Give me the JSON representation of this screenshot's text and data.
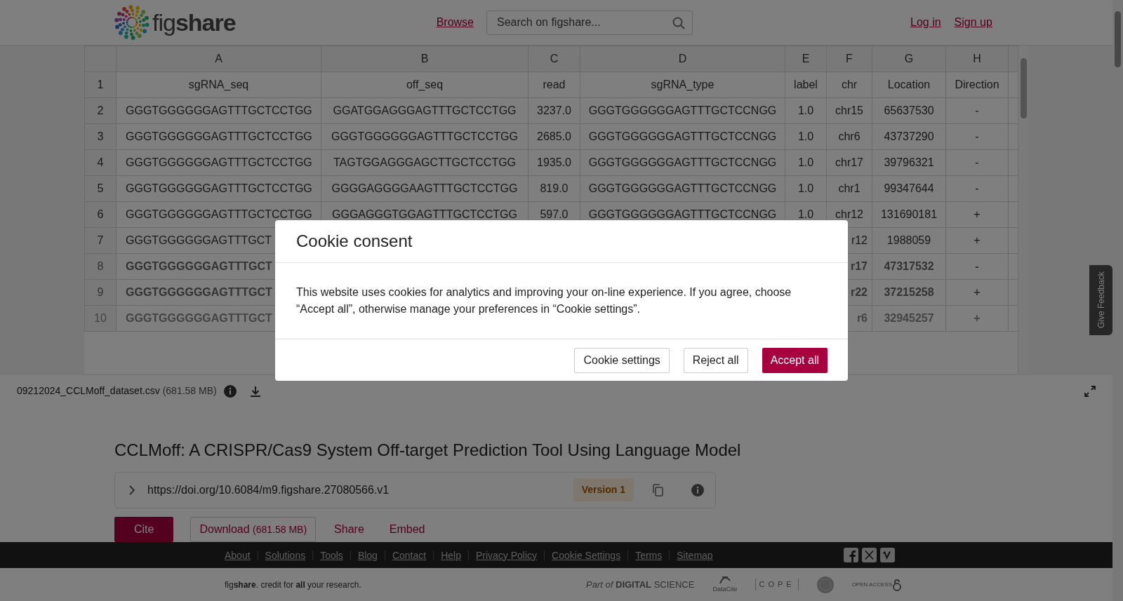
{
  "header": {
    "logo": "fig**share**",
    "nav_link": "Browse",
    "search": {
      "placeholder": "Search on figshare..."
    },
    "auth_links": [
      "Log in",
      "Sign up"
    ]
  },
  "viewer": {
    "columns": [
      "A",
      "B",
      "C",
      "D",
      "E",
      "F",
      "G",
      "H"
    ],
    "rows": [
      {
        "number": "1",
        "kind": "heading",
        "cells": [
          "sgRNA_seq",
          "off_seq",
          "read",
          "sgRNA_type",
          "label",
          "chr",
          "Location",
          "Direction"
        ]
      },
      {
        "number": "2",
        "kind": "data",
        "cells": [
          "GGGTGGGGGGAGTTTGCTCCTGG",
          "GGATGGAGGGAGTTTGCTCCTGG",
          "3237.0",
          "GGGTGGGGGGAGTTTGCTCCNGG",
          "1.0",
          "chr15",
          "65637530",
          "-"
        ]
      },
      {
        "number": "3",
        "kind": "data",
        "cells": [
          "GGGTGGGGGGAGTTTGCTCCTGG",
          "GGGTGGGGGGAGTTTGCTCCTGG",
          "2685.0",
          "GGGTGGGGGGAGTTTGCTCCNGG",
          "1.0",
          "chr6",
          "43737290",
          "-"
        ]
      },
      {
        "number": "4",
        "kind": "data",
        "cells": [
          "GGGTGGGGGGAGTTTGCTCCTGG",
          "TAGTGGAGGGAGCTTGCTCCTGG",
          "1935.0",
          "GGGTGGGGGGAGTTTGCTCCNGG",
          "1.0",
          "chr17",
          "39796321",
          "-"
        ]
      },
      {
        "number": "5",
        "kind": "data",
        "cells": [
          "GGGTGGGGGGAGTTTGCTCCTGG",
          "GGGGAGGGGAAGTTTGCTCCTGG",
          "819.0",
          "GGGTGGGGGGAGTTTGCTCCNGG",
          "1.0",
          "chr1",
          "99347644",
          "-"
        ]
      },
      {
        "number": "6",
        "kind": "data",
        "cells": [
          "GGGTGGGGGGAGTTTGCTCCTGG",
          "GGGAGGGTGGAGTTTGCTCCTGG",
          "597.0",
          "GGGTGGGGGGAGTTTGCTCCNGG",
          "1.0",
          "chr12",
          "131690181",
          "+"
        ]
      },
      {
        "number": "7",
        "kind": "covered",
        "cells": [
          "GGGTGGGGGGAGTTTGCT",
          null,
          null,
          null,
          null,
          "r12",
          "1988059",
          "+"
        ]
      },
      {
        "number": "8",
        "kind": "faded",
        "cells": [
          "GGGTGGGGGGAGTTTGCT",
          null,
          null,
          null,
          null,
          "r17",
          "47317532",
          "-"
        ]
      },
      {
        "number": "9",
        "kind": "faded",
        "cells": [
          "GGGTGGGGGGAGTTTGCT",
          null,
          null,
          null,
          null,
          "r22",
          "37215258",
          "+"
        ]
      },
      {
        "number": "10",
        "kind": "faint",
        "cells": [
          "GGGTGGGGGGAGTTTGCT",
          null,
          null,
          null,
          null,
          "r6",
          "32945257",
          "+"
        ]
      }
    ],
    "file": {
      "name": "09212024_CCLMoff_dataset.csv",
      "size": "(681.58 MB)"
    }
  },
  "item": {
    "title": "CCLMoff: A CRISPR/Cas9 System Off-target Prediction Tool Using Language Model",
    "doi": "https://doi.org/10.6084/m9.figshare.27080566.v1",
    "version": "Version 1",
    "actions": [
      {
        "kind": "primary",
        "label": "Cite"
      },
      {
        "kind": "outline",
        "label": "Download",
        "detail": "(681.58 MB)"
      },
      {
        "kind": "link",
        "label": "Share"
      },
      {
        "kind": "link",
        "label": "Embed"
      }
    ]
  },
  "footer": {
    "links": [
      "About",
      "Solutions",
      "Tools",
      "Blog",
      "Contact",
      "Help",
      "Privacy Policy",
      "Cookie Settings",
      "Terms",
      "Sitemap"
    ],
    "social": [
      {
        "kind": "facebook"
      },
      {
        "kind": "x"
      },
      {
        "kind": "vimeo"
      }
    ]
  },
  "bottom": {
    "tagline": "fig**share**. credit for **all** your research.",
    "partners": [
      {
        "kind": "digital-science",
        "text": "*Part of* **DIGITAL** SCIENCE"
      },
      {
        "kind": "datacite",
        "text": "DataCite"
      },
      {
        "kind": "cope",
        "text": "COPE"
      },
      {
        "kind": "seal"
      },
      {
        "kind": "open-access",
        "text": "OPEN ACCESS"
      }
    ]
  },
  "feedback_tab": "Give Feedback",
  "modal": {
    "title": "Cookie consent",
    "body": "This website uses cookies for analytics and improving your on-line experience. If you agree, choose “Accept all”, otherwise manage your preferences in “Cookie settings”.",
    "buttons": [
      {
        "kind": "outline",
        "label": "Cookie settings"
      },
      {
        "kind": "outline",
        "label": "Reject all"
      },
      {
        "kind": "primary",
        "label": "Accept all"
      }
    ]
  }
}
